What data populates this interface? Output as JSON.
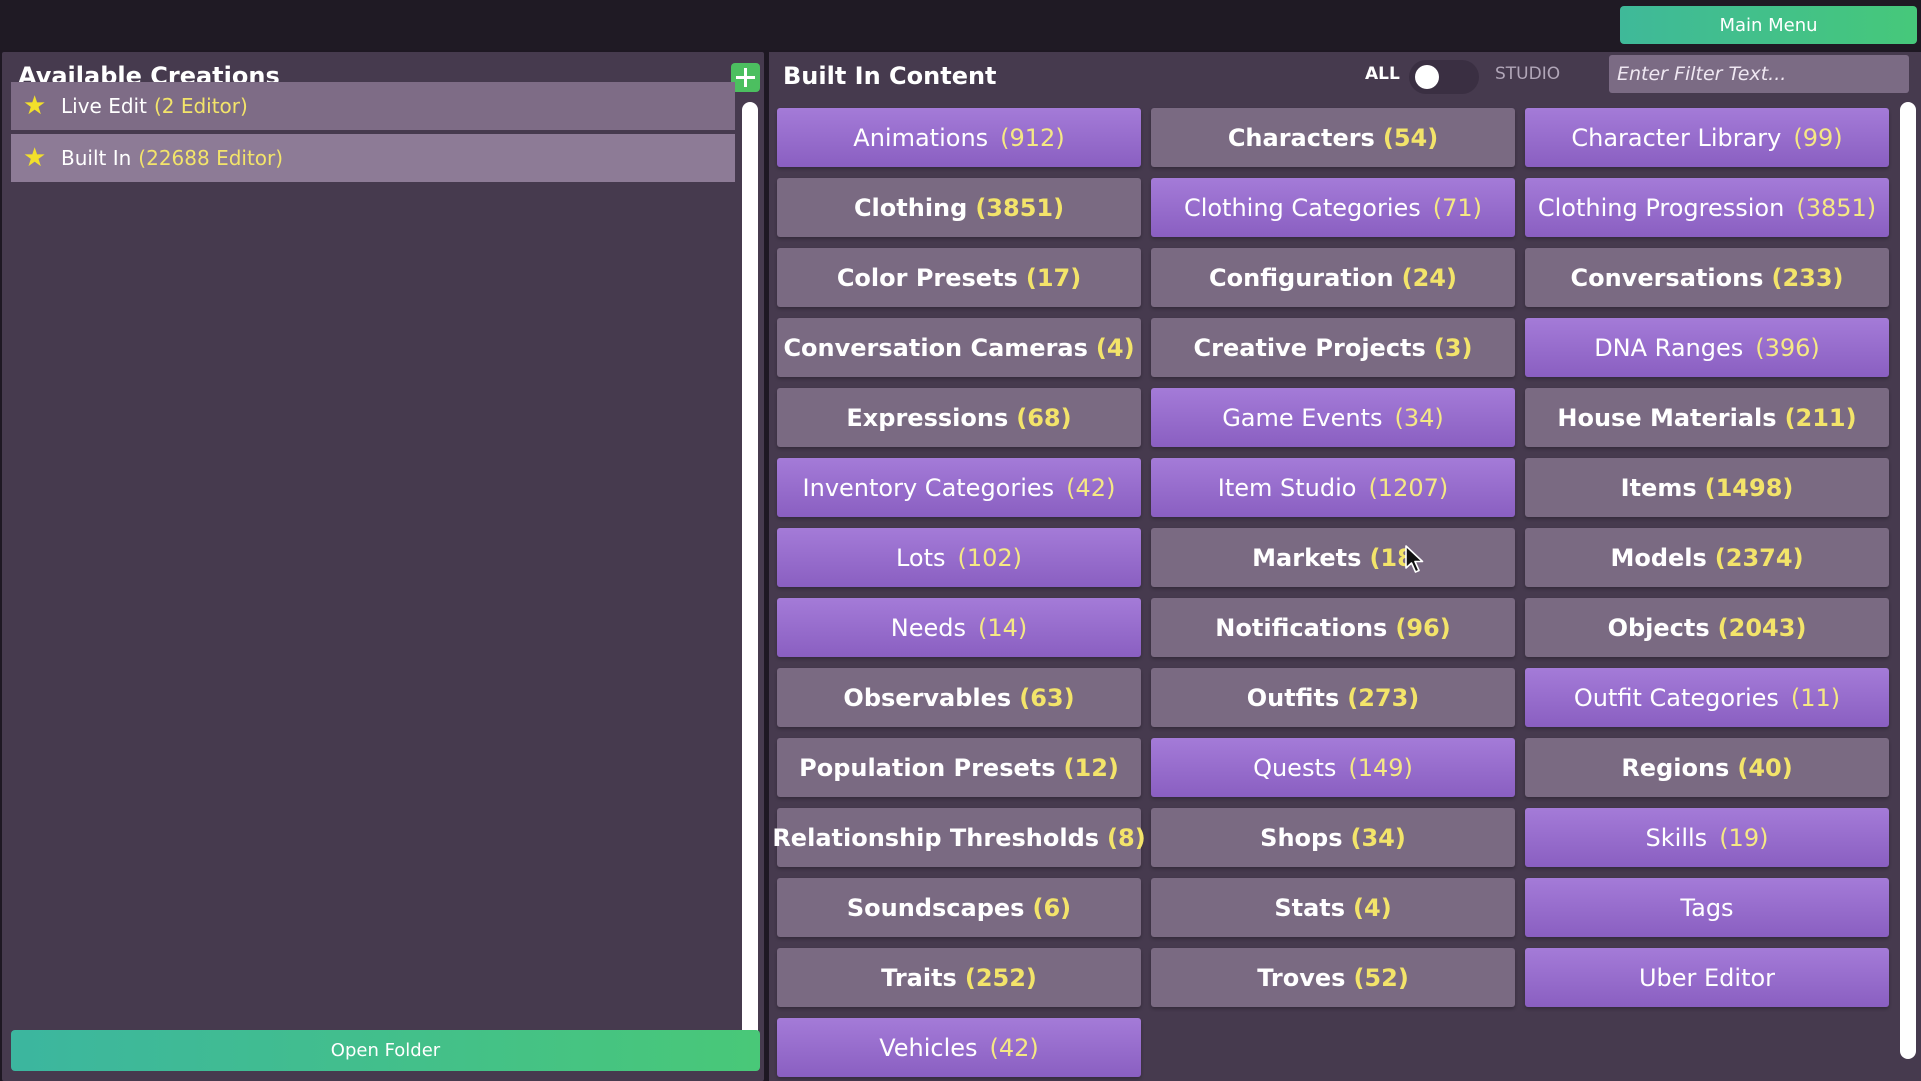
{
  "header": {
    "main_menu_label": "Main Menu"
  },
  "left_panel": {
    "title": "Available Creations",
    "items": [
      {
        "label": "Live Edit",
        "count": "(2 Editor)"
      },
      {
        "label": "Built In",
        "count": "(22688 Editor)"
      }
    ],
    "open_folder_label": "Open Folder"
  },
  "right_panel": {
    "title": "Built In Content",
    "toggle": {
      "left_label": "ALL",
      "right_label": "STUDIO"
    },
    "filter_placeholder": "Enter Filter Text...",
    "tiles": [
      {
        "label": "Animations",
        "count": "(912)",
        "style": "purple"
      },
      {
        "label": "Characters",
        "count": "(54)",
        "style": "gray"
      },
      {
        "label": "Character Library",
        "count": "(99)",
        "style": "purple"
      },
      {
        "label": "Clothing",
        "count": "(3851)",
        "style": "gray"
      },
      {
        "label": "Clothing Categories",
        "count": "(71)",
        "style": "purple"
      },
      {
        "label": "Clothing Progression",
        "count": "(3851)",
        "style": "purple"
      },
      {
        "label": "Color Presets",
        "count": "(17)",
        "style": "gray"
      },
      {
        "label": "Configuration",
        "count": "(24)",
        "style": "gray"
      },
      {
        "label": "Conversations",
        "count": "(233)",
        "style": "gray"
      },
      {
        "label": "Conversation Cameras",
        "count": "(4)",
        "style": "gray"
      },
      {
        "label": "Creative Projects",
        "count": "(3)",
        "style": "gray"
      },
      {
        "label": "DNA Ranges",
        "count": "(396)",
        "style": "purple"
      },
      {
        "label": "Expressions",
        "count": "(68)",
        "style": "gray"
      },
      {
        "label": "Game Events",
        "count": "(34)",
        "style": "purple"
      },
      {
        "label": "House Materials",
        "count": "(211)",
        "style": "gray"
      },
      {
        "label": "Inventory Categories",
        "count": "(42)",
        "style": "purple"
      },
      {
        "label": "Item Studio",
        "count": "(1207)",
        "style": "purple"
      },
      {
        "label": "Items",
        "count": "(1498)",
        "style": "gray"
      },
      {
        "label": "Lots",
        "count": "(102)",
        "style": "purple"
      },
      {
        "label": "Markets",
        "count": "(18",
        "style": "gray"
      },
      {
        "label": "Models",
        "count": "(2374)",
        "style": "gray"
      },
      {
        "label": "Needs",
        "count": "(14)",
        "style": "purple"
      },
      {
        "label": "Notifications",
        "count": "(96)",
        "style": "gray"
      },
      {
        "label": "Objects",
        "count": "(2043)",
        "style": "gray"
      },
      {
        "label": "Observables",
        "count": "(63)",
        "style": "gray"
      },
      {
        "label": "Outfits",
        "count": "(273)",
        "style": "gray"
      },
      {
        "label": "Outfit Categories",
        "count": "(11)",
        "style": "purple"
      },
      {
        "label": "Population Presets",
        "count": "(12)",
        "style": "gray"
      },
      {
        "label": "Quests",
        "count": "(149)",
        "style": "purple"
      },
      {
        "label": "Regions",
        "count": "(40)",
        "style": "gray"
      },
      {
        "label": "Relationship Thresholds",
        "count": "(8)",
        "style": "gray"
      },
      {
        "label": "Shops",
        "count": "(34)",
        "style": "gray"
      },
      {
        "label": "Skills",
        "count": "(19)",
        "style": "purple"
      },
      {
        "label": "Soundscapes",
        "count": "(6)",
        "style": "gray"
      },
      {
        "label": "Stats",
        "count": "(4)",
        "style": "gray"
      },
      {
        "label": "Tags",
        "count": "",
        "style": "purple"
      },
      {
        "label": "Traits",
        "count": "(252)",
        "style": "gray"
      },
      {
        "label": "Troves",
        "count": "(52)",
        "style": "gray"
      },
      {
        "label": "Uber Editor",
        "count": "",
        "style": "purple"
      },
      {
        "label": "Vehicles",
        "count": "(42)",
        "style": "purple"
      }
    ]
  },
  "colors": {
    "background": "#463a4e",
    "tile_gray": "#7a6a82",
    "tile_purple": "#9a6fd0",
    "count_yellow": "#f3e46a",
    "accent_green": "#46c87a"
  }
}
